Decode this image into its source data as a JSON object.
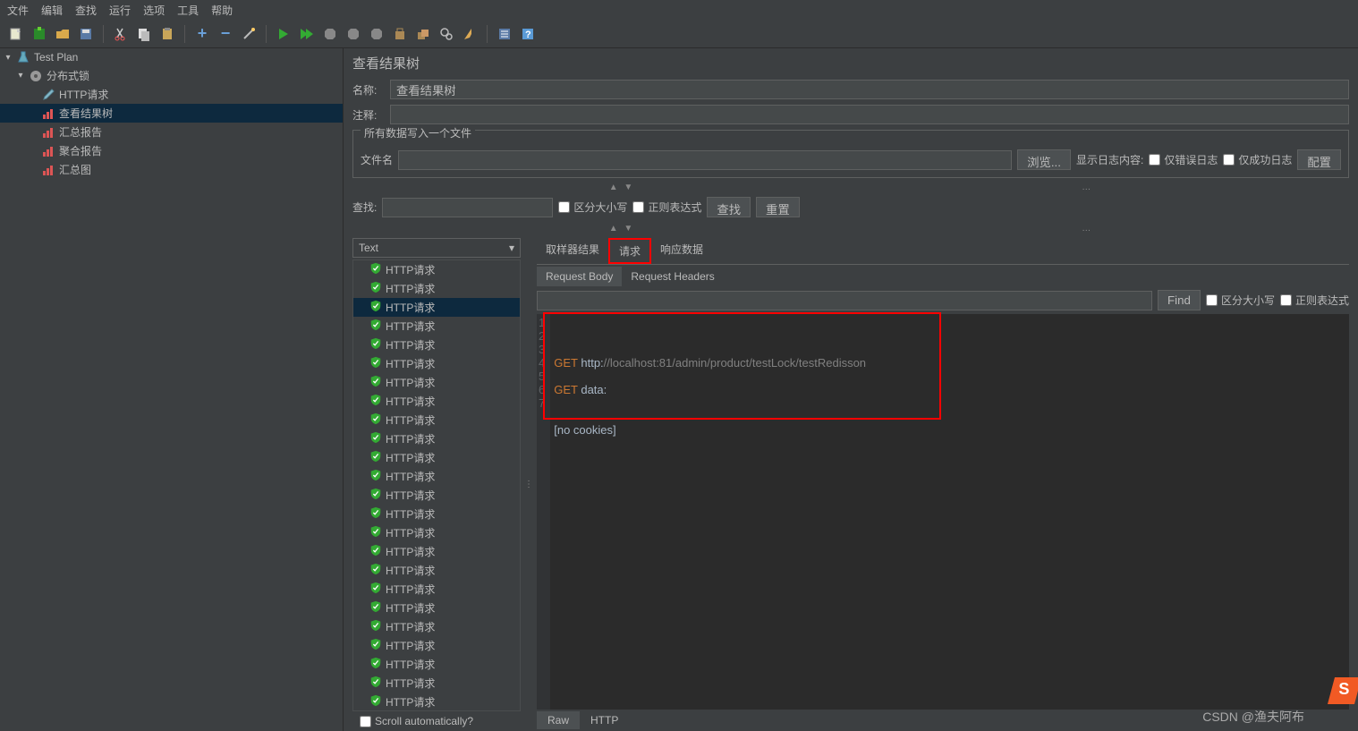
{
  "menubar": [
    "文件",
    "编辑",
    "查找",
    "运行",
    "选项",
    "工具",
    "帮助"
  ],
  "tree": {
    "root": "Test Plan",
    "group": "分布式锁",
    "children": [
      {
        "label": "HTTP请求",
        "icon": "dropper"
      },
      {
        "label": "查看结果树",
        "icon": "chart",
        "selected": true
      },
      {
        "label": "汇总报告",
        "icon": "chart"
      },
      {
        "label": "聚合报告",
        "icon": "chart"
      },
      {
        "label": "汇总图",
        "icon": "chart"
      }
    ]
  },
  "panel": {
    "title": "查看结果树",
    "name_label": "名称:",
    "name_value": "查看结果树",
    "comment_label": "注释:",
    "file_section_title": "所有数据写入一个文件",
    "file_label": "文件名",
    "browse_btn": "浏览...",
    "log_content_label": "显示日志内容:",
    "err_only": "仅错误日志",
    "success_only": "仅成功日志",
    "config_btn": "配置",
    "search_label": "查找:",
    "case_sensitive": "区分大小写",
    "regex": "正则表达式",
    "find_btn": "查找",
    "reset_btn": "重置"
  },
  "results": {
    "renderer": "Text",
    "items": [
      "HTTP请求",
      "HTTP请求",
      "HTTP请求",
      "HTTP请求",
      "HTTP请求",
      "HTTP请求",
      "HTTP请求",
      "HTTP请求",
      "HTTP请求",
      "HTTP请求",
      "HTTP请求",
      "HTTP请求",
      "HTTP请求",
      "HTTP请求",
      "HTTP请求",
      "HTTP请求",
      "HTTP请求",
      "HTTP请求",
      "HTTP请求",
      "HTTP请求",
      "HTTP请求",
      "HTTP请求",
      "HTTP请求",
      "HTTP请求"
    ],
    "selected_index": 2,
    "scroll_auto": "Scroll automatically?",
    "tabs": [
      "取样器结果",
      "请求",
      "响应数据"
    ],
    "active_tab": 1,
    "subtabs": [
      "Request Body",
      "Request Headers"
    ],
    "active_subtab": 0,
    "find": "Find",
    "case": "区分大小写",
    "regex2": "正则表达式",
    "code_lines": [
      "GET http://localhost:81/admin/product/testLock/testRedisson",
      "",
      "GET data:",
      "",
      "",
      "[no cookies]",
      ""
    ],
    "bottom_tabs": [
      "Raw",
      "HTTP"
    ],
    "active_bottom": 0
  },
  "watermark": "CSDN @渔夫阿布"
}
